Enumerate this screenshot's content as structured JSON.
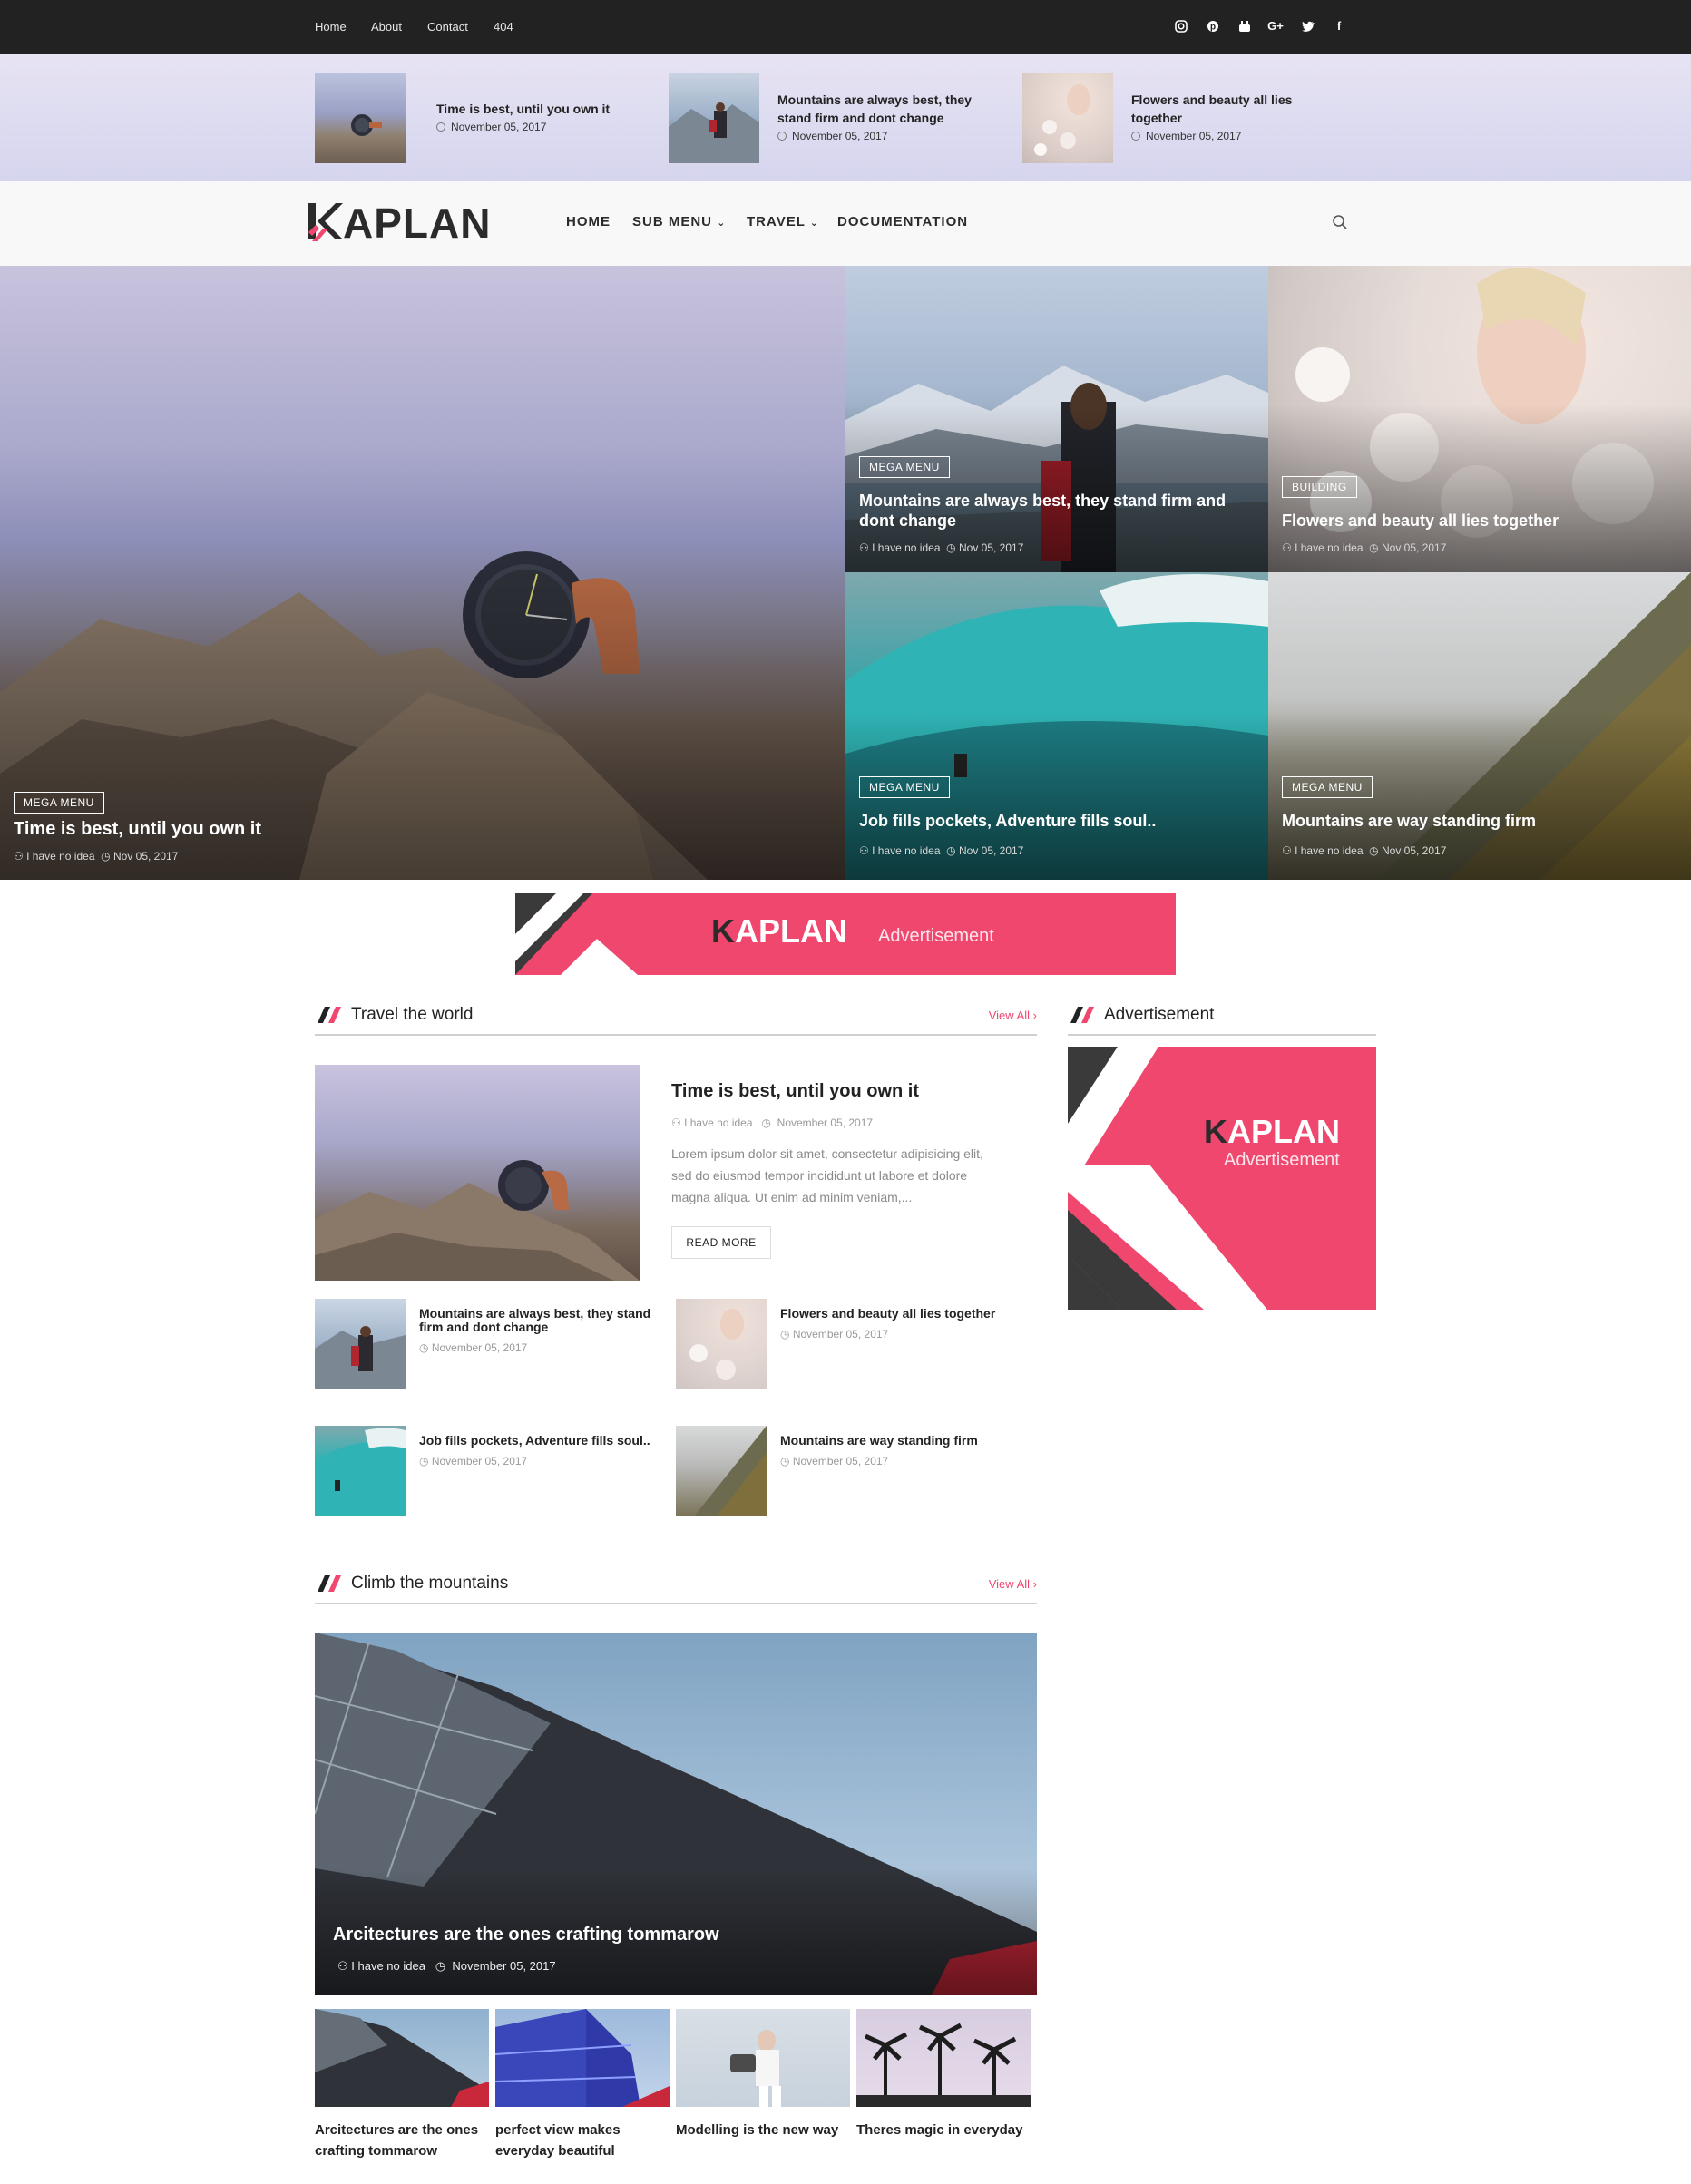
{
  "colors": {
    "accent": "#f0476f",
    "dark": "#222222",
    "text": "#222222",
    "muted": "#999999"
  },
  "topbar": {
    "links": [
      "Home",
      "About",
      "Contact",
      "404"
    ],
    "social_icons": [
      "instagram-icon",
      "pinterest-icon",
      "youtube-icon",
      "google-plus-icon",
      "twitter-icon",
      "facebook-icon"
    ],
    "social_glyphs": [
      "◎",
      "℗",
      "▶",
      "G+",
      "🐦",
      "f"
    ]
  },
  "trending": [
    {
      "title": "Time is best, until you own it",
      "date": "November 05, 2017"
    },
    {
      "title": "Mountains are always best, they stand firm and dont change",
      "date": "November 05, 2017"
    },
    {
      "title": "Flowers and beauty all lies together",
      "date": "November 05, 2017"
    }
  ],
  "header": {
    "logo": "APLAN",
    "nav": [
      "HOME",
      "SUB MENU",
      "TRAVEL",
      "DOCUMENTATION"
    ],
    "search_icon": "search-icon"
  },
  "hero": {
    "main": {
      "category": "MEGA MENU",
      "title": "Time is best, until you own it",
      "author": "I have no idea",
      "date": "Nov 05, 2017"
    },
    "tiles": [
      {
        "category": "MEGA MENU",
        "title": "Mountains are always best, they stand firm and dont change",
        "author": "I have no idea",
        "date": "Nov 05, 2017"
      },
      {
        "category": "BUILDING",
        "title": "Flowers and beauty all lies together",
        "author": "I have no idea",
        "date": "Nov 05, 2017"
      },
      {
        "category": "MEGA MENU",
        "title": "Job fills pockets, Adventure fills soul..",
        "author": "I have no idea",
        "date": "Nov 05, 2017"
      },
      {
        "category": "MEGA MENU",
        "title": "Mountains are way standing firm",
        "author": "I have no idea",
        "date": "Nov 05, 2017"
      }
    ]
  },
  "ad_banner": {
    "logo": "APLAN",
    "label": "Advertisement"
  },
  "travel": {
    "title": "Travel the world",
    "view_all": "View All",
    "featured": {
      "title": "Time is best, until you own it",
      "author": "I have no idea",
      "date": "November 05, 2017",
      "excerpt": "Lorem ipsum dolor sit amet, consectetur adipisicing elit, sed do eiusmod tempor incididunt ut labore et dolore magna aliqua. Ut enim ad minim veniam,...",
      "button": "READ MORE"
    },
    "items": [
      {
        "title": "Mountains are always best, they stand firm and dont change",
        "date": "November 05, 2017"
      },
      {
        "title": "Flowers and beauty all lies together",
        "date": "November 05, 2017"
      },
      {
        "title": "Job fills pockets, Adventure fills soul..",
        "date": "November 05, 2017"
      },
      {
        "title": "Mountains are way standing firm",
        "date": "November 05, 2017"
      }
    ]
  },
  "sidebar": {
    "title": "Advertisement",
    "ad": {
      "logo": "APLAN",
      "label": "Advertisement"
    }
  },
  "climb": {
    "title": "Climb the mountains",
    "view_all": "View All",
    "featured": {
      "title": "Arcitectures are the ones crafting tommarow",
      "author": "I have no idea",
      "date": "November 05, 2017"
    },
    "items": [
      {
        "title": "Arcitectures are the ones crafting tommarow"
      },
      {
        "title": "perfect view makes everyday beautiful"
      },
      {
        "title": "Modelling is the new way"
      },
      {
        "title": "Theres magic in everyday"
      }
    ]
  }
}
